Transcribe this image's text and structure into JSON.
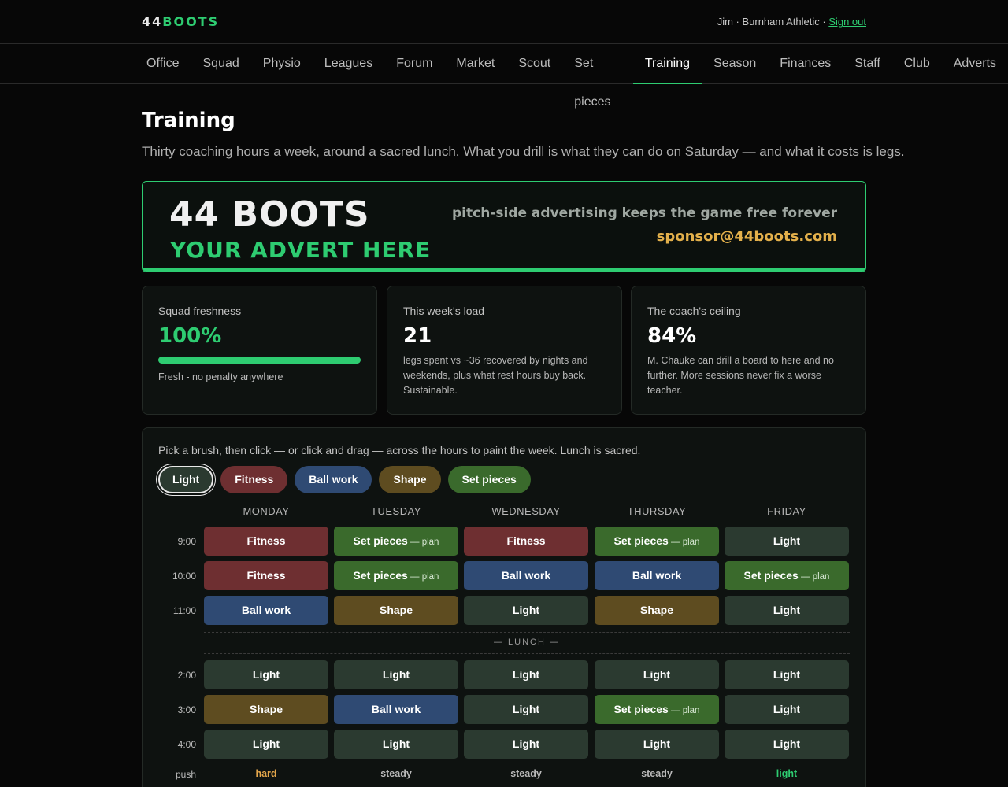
{
  "header": {
    "logo_num": "44",
    "logo_word": "BOOTS",
    "account_text": "Jim · Burnham Athletic · ",
    "sign_out": "Sign out"
  },
  "nav": {
    "items": [
      "Office",
      "Squad",
      "Physio",
      "Leagues",
      "Forum",
      "Market",
      "Scout",
      "Set pieces",
      "Training",
      "Season",
      "Finances",
      "Staff",
      "Club",
      "Adverts"
    ],
    "active": "Training"
  },
  "page": {
    "title": "Training",
    "subtitle": "Thirty coaching hours a week, around a sacred lunch. What you drill is what they can do on Saturday — and what it costs is legs."
  },
  "advert": {
    "brand": "44 BOOTS",
    "cta": "YOUR ADVERT HERE",
    "tagline": "pitch-side advertising keeps the game free forever",
    "email": "sponsor@44boots.com"
  },
  "cards": {
    "freshness": {
      "label": "Squad freshness",
      "value": "100%",
      "fill_percent": 100,
      "note": "Fresh - no penalty anywhere"
    },
    "load": {
      "label": "This week's load",
      "value": "21",
      "note": "legs spent vs ~36 recovered by nights and weekends, plus what rest hours buy back. Sustainable."
    },
    "ceiling": {
      "label": "The coach's ceiling",
      "value": "84%",
      "note": "M. Chauke can drill a board to here and no further. More sessions never fix a worse teacher."
    }
  },
  "planner": {
    "hint": "Pick a brush, then click — or click and drag — across the hours to paint the week. Lunch is sacred.",
    "brushes": [
      {
        "label": "Light",
        "color": "#2b3a30",
        "selected": true
      },
      {
        "label": "Fitness",
        "color": "#6e2f31",
        "selected": false
      },
      {
        "label": "Ball work",
        "color": "#2f4a73",
        "selected": false
      },
      {
        "label": "Shape",
        "color": "#5e4c20",
        "selected": false
      },
      {
        "label": "Set pieces",
        "color": "#3a6a2c",
        "selected": false
      }
    ],
    "days": [
      "MONDAY",
      "TUESDAY",
      "WEDNESDAY",
      "THURSDAY",
      "FRIDAY"
    ],
    "morning_hours": [
      "9:00",
      "10:00",
      "11:00"
    ],
    "afternoon_hours": [
      "2:00",
      "3:00",
      "4:00"
    ],
    "lunch_label": "— LUNCH —",
    "plan_suffix": " — plan",
    "grid": [
      [
        "Fitness",
        "Set pieces",
        "Fitness",
        "Set pieces",
        "Light"
      ],
      [
        "Fitness",
        "Set pieces",
        "Ball work",
        "Ball work",
        "Set pieces"
      ],
      [
        "Ball work",
        "Shape",
        "Light",
        "Shape",
        "Light"
      ],
      [
        "Light",
        "Light",
        "Light",
        "Light",
        "Light"
      ],
      [
        "Shape",
        "Ball work",
        "Light",
        "Set pieces",
        "Light"
      ],
      [
        "Light",
        "Light",
        "Light",
        "Light",
        "Light"
      ]
    ],
    "push_label": "push",
    "push": [
      {
        "text": "hard",
        "color": "#e3a64b"
      },
      {
        "text": "steady",
        "color": "#b8b8b8"
      },
      {
        "text": "steady",
        "color": "#b8b8b8"
      },
      {
        "text": "steady",
        "color": "#b8b8b8"
      },
      {
        "text": "light",
        "color": "#2ecc71"
      }
    ]
  }
}
